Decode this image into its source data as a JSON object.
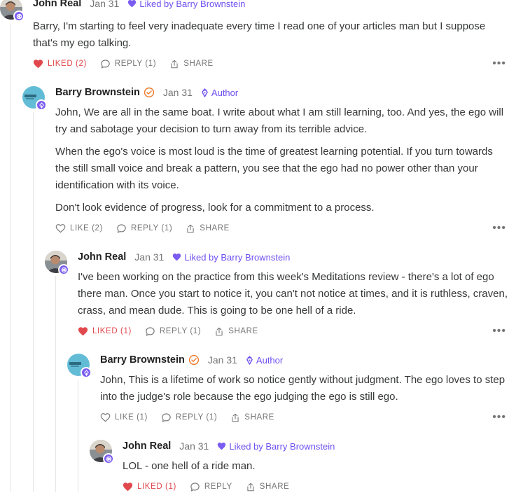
{
  "comments": [
    {
      "name": "John Real",
      "date": "Jan 31",
      "liked_by": "Liked by Barry Brownstein",
      "text": [
        "Barry, I'm starting to feel very inadequate every time I read one of your articles man but I suppose that's my ego talking."
      ],
      "like_label": "LIKED (2)",
      "reply_label": "REPLY (1)",
      "share_label": "SHARE"
    },
    {
      "name": "Barry Brownstein",
      "date": "Jan 31",
      "author_label": "Author",
      "text": [
        "John, We are all in the same boat. I write about what I am still learning, too. And yes, the ego will try and sabotage your decision to turn away from its terrible advice.",
        "When the ego's voice is most loud is the time of greatest learning potential. If you turn towards the still small voice and break a pattern, you see that the ego had no power other than your identification with its voice.",
        "Don't look evidence of progress, look for a commitment to a process."
      ],
      "like_label": "LIKE (2)",
      "reply_label": "REPLY (1)",
      "share_label": "SHARE"
    },
    {
      "name": "John Real",
      "date": "Jan 31",
      "liked_by": "Liked by Barry Brownstein",
      "text": [
        "I've been working on the practice from this week's Meditations review - there's a lot of ego there man. Once you start to notice it, you can't not notice at times, and it is ruthless, craven, crass, and mean dude. This is going to be one hell of a ride."
      ],
      "like_label": "LIKED (1)",
      "reply_label": "REPLY (1)",
      "share_label": "SHARE"
    },
    {
      "name": "Barry Brownstein",
      "date": "Jan 31",
      "author_label": "Author",
      "text": [
        "John, This is a lifetime of work so notice gently without judgment. The ego loves to step into the judge's role because the ego judging the ego is still ego."
      ],
      "like_label": "LIKE (1)",
      "reply_label": "REPLY (1)",
      "share_label": "SHARE"
    },
    {
      "name": "John Real",
      "date": "Jan 31",
      "liked_by": "Liked by Barry Brownstein",
      "text": [
        "LOL - one hell of a ride man."
      ],
      "like_label": "LIKED (1)",
      "reply_label": "REPLY",
      "share_label": "SHARE"
    }
  ],
  "colors": {
    "accent": "#6e4ff0",
    "liked": "#e0484d",
    "meta": "#757575",
    "verified": "#f07a2b"
  },
  "icons": {
    "liked": "heart-filled-icon",
    "like": "heart-outline-icon",
    "reply": "comment-bubble-icon",
    "share": "share-icon",
    "more": "more-dots-icon",
    "liked_by": "heart-filled-icon",
    "author": "pen-nib-icon",
    "verified": "check-circle-icon",
    "badge": "snowflake-badge-icon"
  }
}
